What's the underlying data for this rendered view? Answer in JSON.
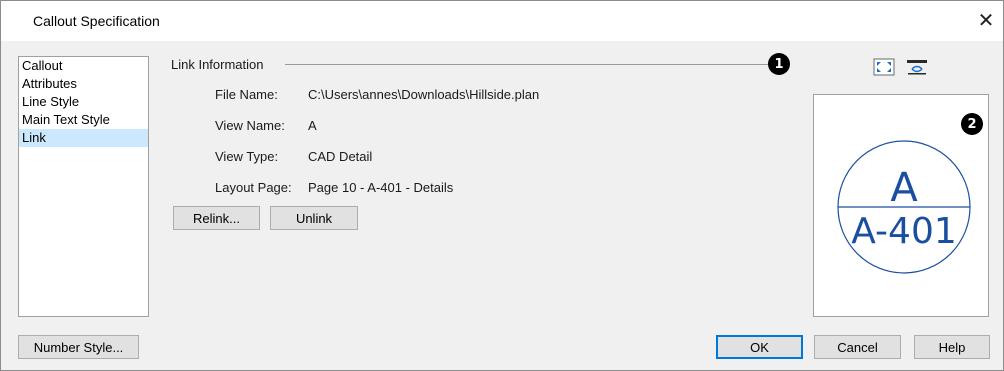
{
  "window": {
    "title": "Callout Specification",
    "close_glyph": "✕"
  },
  "sidebar": {
    "items": [
      {
        "label": "Callout",
        "selected": false
      },
      {
        "label": "Attributes",
        "selected": false
      },
      {
        "label": "Line Style",
        "selected": false
      },
      {
        "label": "Main Text Style",
        "selected": false
      },
      {
        "label": "Link",
        "selected": true
      }
    ]
  },
  "link_info": {
    "group_title": "Link Information",
    "fields": [
      {
        "label": "File Name:",
        "value": "C:\\Users\\annes\\Downloads\\Hillside.plan"
      },
      {
        "label": "View Name:",
        "value": "A"
      },
      {
        "label": "View Type:",
        "value": "CAD Detail"
      },
      {
        "label": "Layout Page:",
        "value": "Page 10 - A-401 - Details"
      }
    ],
    "relink_label": "Relink...",
    "unlink_label": "Unlink"
  },
  "annotations": {
    "badge_1": "1",
    "badge_2": "2"
  },
  "preview": {
    "top_text": "A",
    "bottom_text": "A-401",
    "stroke_color": "#1a4fa0",
    "icons": [
      "fill-window-icon",
      "preview-view-icon"
    ]
  },
  "footer": {
    "number_style_label": "Number Style...",
    "ok_label": "OK",
    "cancel_label": "Cancel",
    "help_label": "Help"
  },
  "colors": {
    "dialog_bg": "#f0f0f0",
    "selection_bg": "#cce8ff",
    "default_button_border": "#0078d7"
  }
}
